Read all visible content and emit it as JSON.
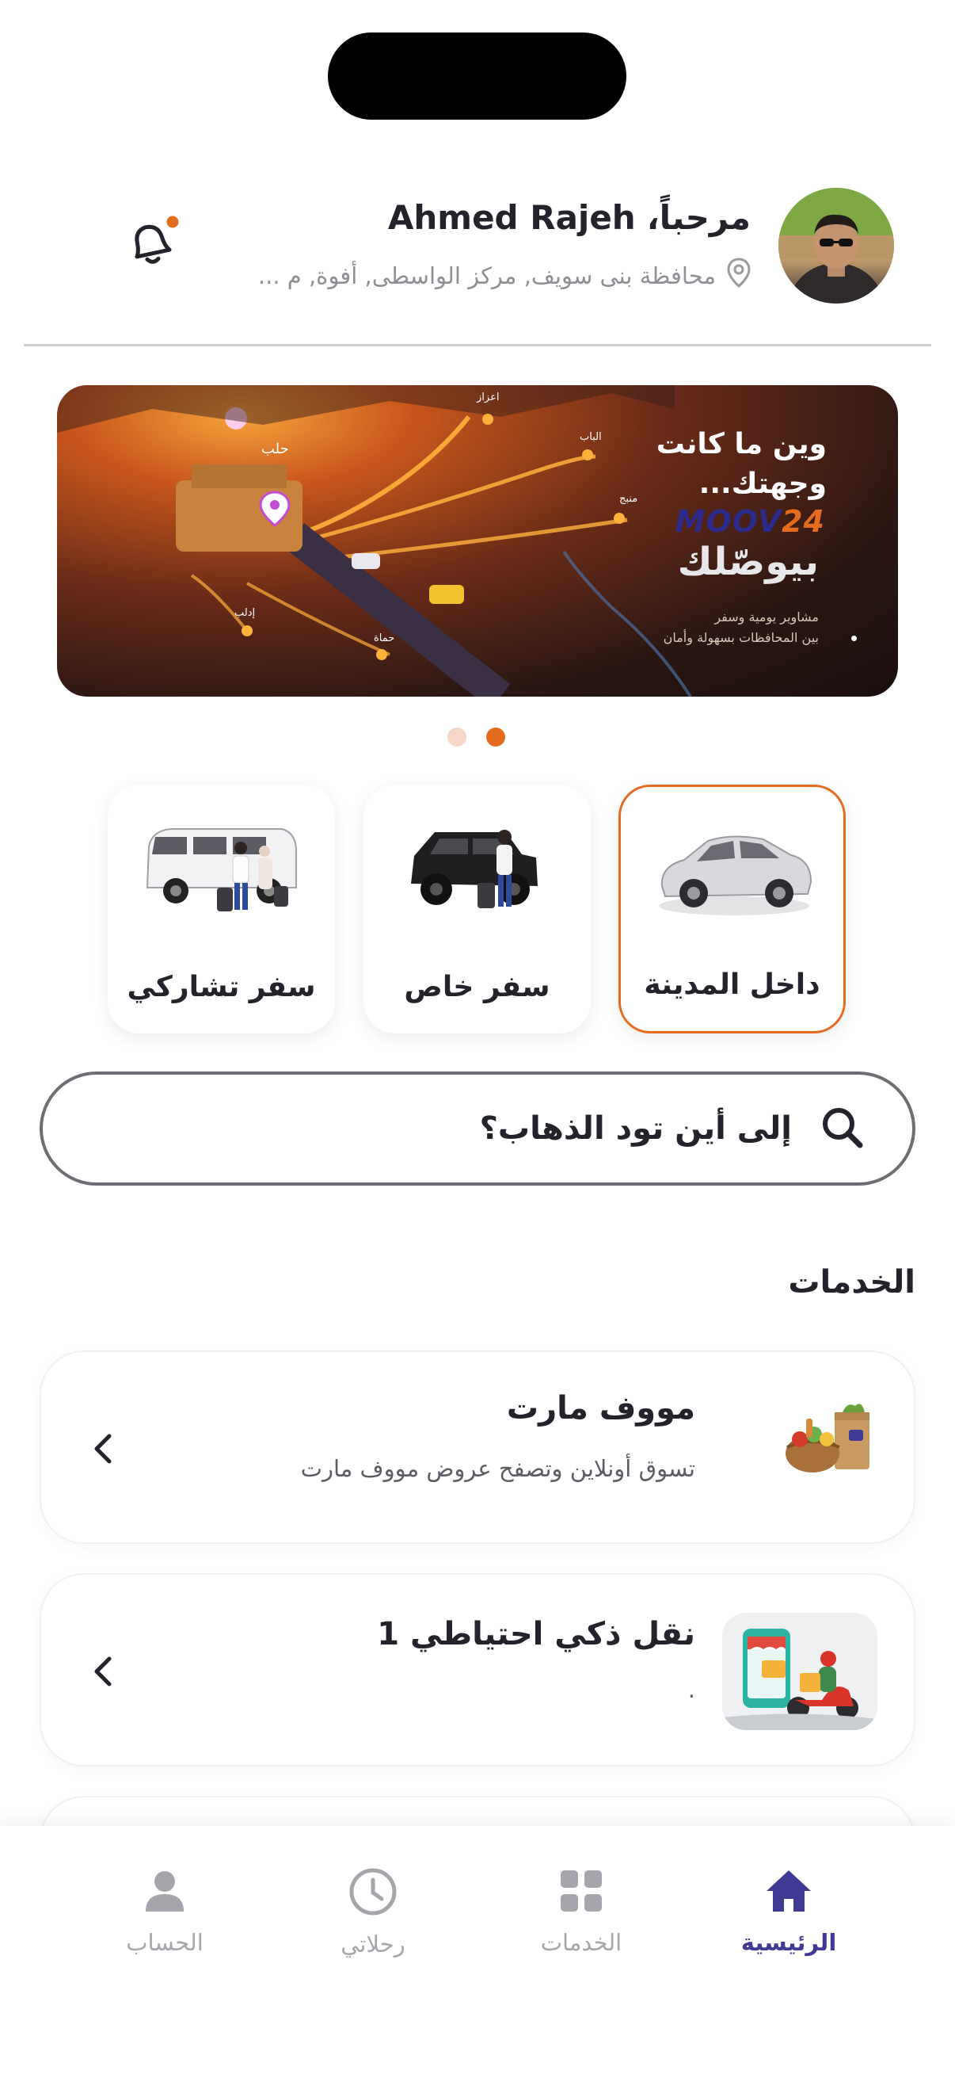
{
  "header": {
    "greeting": "مرحباً،",
    "user_name": "Ahmed Rajeh",
    "location": "محافظة بنى سويف, مركز الواسطى, أفوة, م ...",
    "icons": {
      "notification": "bell-icon",
      "location": "location-pin-icon"
    },
    "notification_dot_color": "#e56b1f"
  },
  "banner": {
    "headline_1": "وين ما كانت",
    "headline_2": "وجهتك...",
    "brand_a": "MOOV",
    "brand_b": "24",
    "tagline": "بيوصّلك",
    "small_1": "مشاوير يومية وسفر",
    "small_2": "بين المحافظات بسهولة وأمان",
    "cities": [
      "حلب",
      "اعزاز",
      "الباب",
      "منبج",
      "إدلب",
      "حماة"
    ],
    "active_slide": 2,
    "slide_count": 2
  },
  "ride_types": [
    {
      "label": "داخل المدينة",
      "icon": "sedan-car-icon",
      "selected": true
    },
    {
      "label": "سفر خاص",
      "icon": "jeep-traveler-icon",
      "selected": false
    },
    {
      "label": "سفر تشاركي",
      "icon": "van-travelers-icon",
      "selected": false
    }
  ],
  "search": {
    "placeholder": "إلى أين تود الذهاب؟",
    "icon": "search-icon"
  },
  "services": {
    "title": "الخدمات",
    "items": [
      {
        "title": "مووف مارت",
        "subtitle": "تسوق أونلاين وتصفح عروض مووف مارت",
        "icon": "grocery-basket-icon"
      },
      {
        "title": "نقل ذكي احتياطي 1",
        "subtitle": ".",
        "icon": "delivery-scooter-icon"
      }
    ]
  },
  "nav": {
    "items": [
      {
        "label": "الرئيسية",
        "icon": "home-icon",
        "active": true
      },
      {
        "label": "الخدمات",
        "icon": "grid-icon",
        "active": false
      },
      {
        "label": "رحلاتي",
        "icon": "clock-icon",
        "active": false
      },
      {
        "label": "الحساب",
        "icon": "person-icon",
        "active": false
      }
    ]
  },
  "colors": {
    "accent": "#e56b1f",
    "brand": "#3f3a94",
    "muted": "#a5a5ab"
  }
}
